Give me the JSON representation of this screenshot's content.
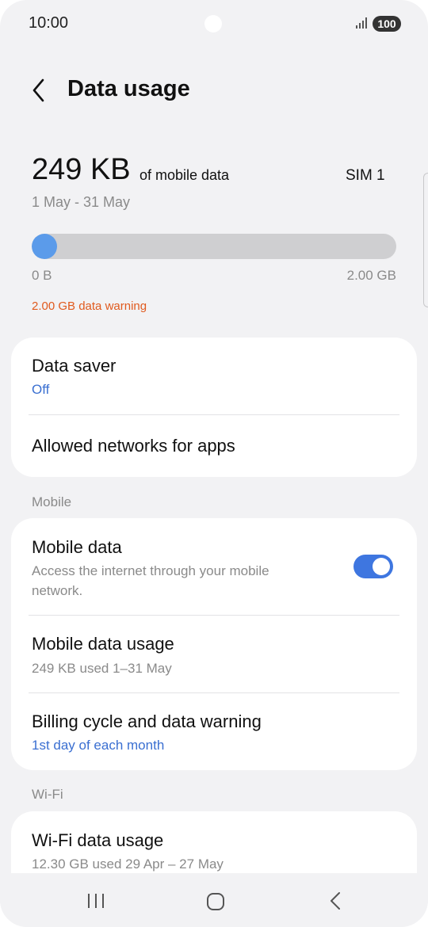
{
  "status_bar": {
    "time": "10:00",
    "battery": "100"
  },
  "header": {
    "title": "Data usage"
  },
  "usage": {
    "amount": "249 KB",
    "of_text": "of mobile data",
    "sim": "SIM 1",
    "date_range": "1 May - 31 May",
    "progress_fraction": 0.07,
    "start_label": "0 B",
    "end_label": "2.00 GB",
    "warning": "2.00 GB data warning"
  },
  "card1": {
    "data_saver": {
      "title": "Data saver",
      "value": "Off"
    },
    "allowed_networks": {
      "title": "Allowed networks for apps"
    }
  },
  "mobile_section": {
    "label": "Mobile",
    "mobile_data": {
      "title": "Mobile data",
      "sub_line1": "Access the internet through your mobile",
      "sub_line2": "network.",
      "enabled": true
    },
    "mobile_data_usage": {
      "title": "Mobile data usage",
      "sub": "249 KB used 1–31 May"
    },
    "billing": {
      "title": "Billing cycle and data warning",
      "sub": "1st day of each month"
    }
  },
  "wifi_section": {
    "label": "Wi-Fi",
    "wifi_usage": {
      "title": "Wi-Fi data usage",
      "sub": "12.30 GB used 29 Apr – 27 May"
    }
  },
  "colors": {
    "accent": "#3e76e0",
    "progress": "#5b9bea",
    "warning": "#e05a1e",
    "link": "#3a6fd1"
  }
}
